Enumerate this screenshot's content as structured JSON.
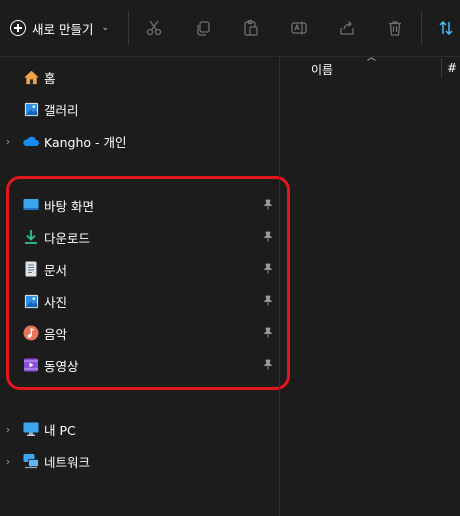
{
  "toolbar": {
    "new_label": "새로 만들기",
    "buttons": [
      "cut-icon",
      "copy-icon",
      "paste-icon",
      "rename-icon",
      "share-icon",
      "delete-icon",
      "sort-icon"
    ]
  },
  "nav": {
    "top": [
      {
        "label": "홈",
        "icon": "home-icon"
      },
      {
        "label": "갤러리",
        "icon": "gallery-icon"
      },
      {
        "label": "Kangho - 개인",
        "icon": "onedrive-icon",
        "expandable": true
      }
    ],
    "quick_access": [
      {
        "label": "바탕 화면",
        "icon": "desktop-icon",
        "pinned": true
      },
      {
        "label": "다운로드",
        "icon": "downloads-icon",
        "pinned": true
      },
      {
        "label": "문서",
        "icon": "documents-icon",
        "pinned": true
      },
      {
        "label": "사진",
        "icon": "pictures-icon",
        "pinned": true
      },
      {
        "label": "음악",
        "icon": "music-icon",
        "pinned": true
      },
      {
        "label": "동영상",
        "icon": "videos-icon",
        "pinned": true
      }
    ],
    "bottom": [
      {
        "label": "내 PC",
        "icon": "this-pc-icon",
        "expandable": true
      },
      {
        "label": "네트워크",
        "icon": "network-icon",
        "expandable": true
      }
    ]
  },
  "content": {
    "column_name": "이름",
    "column_hash": "#"
  },
  "colors": {
    "background": "#1c1c1c",
    "highlight": "#e2161f",
    "accent": "#4cc2ff"
  }
}
